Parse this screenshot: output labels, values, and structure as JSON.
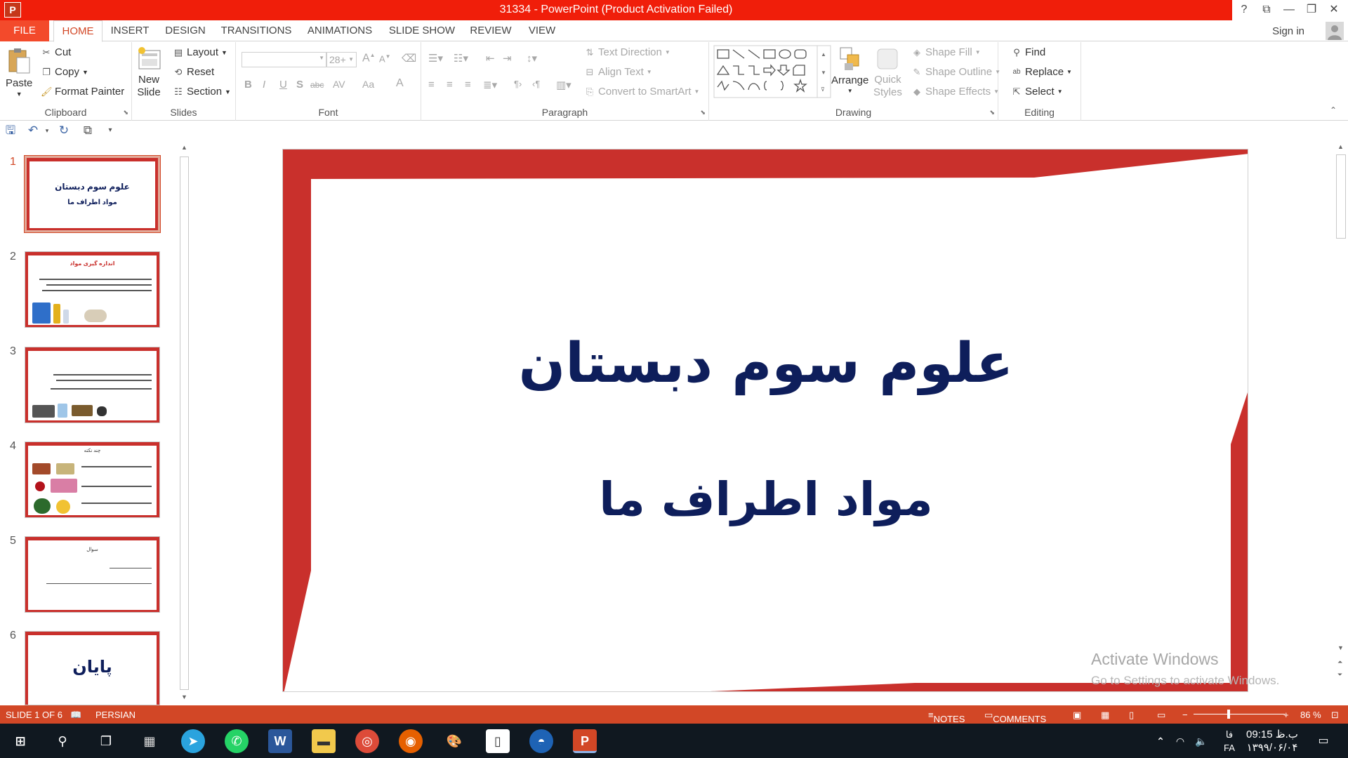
{
  "window": {
    "title": "31334 -  PowerPoint (Product Activation Failed)",
    "app_icon_letter": "P",
    "controls": [
      "?",
      "⧉",
      "—",
      "❐",
      "✕"
    ],
    "title_color": "#f01e0a"
  },
  "tabs": [
    "FILE",
    "HOME",
    "INSERT",
    "DESIGN",
    "TRANSITIONS",
    "ANIMATIONS",
    "SLIDE SHOW",
    "REVIEW",
    "VIEW"
  ],
  "active_tab": "HOME",
  "signin": "Sign in",
  "ribbon": {
    "clipboard": {
      "label": "Clipboard",
      "paste": "Paste",
      "cut": "Cut",
      "copy": "Copy",
      "format_painter": "Format Painter"
    },
    "slides": {
      "label": "Slides",
      "new_slide": "New",
      "new_slide_2": "Slide",
      "layout": "Layout",
      "reset": "Reset",
      "section": "Section"
    },
    "font": {
      "label": "Font",
      "font_name": "",
      "font_size": "28+",
      "bold": "B",
      "italic": "I",
      "underline": "U",
      "shadow": "S",
      "strike": "abc",
      "spacing": "AV",
      "case": "Aa",
      "color": "A"
    },
    "paragraph": {
      "label": "Paragraph",
      "text_direction": "Text Direction",
      "align_text": "Align Text",
      "convert_smartart": "Convert to SmartArt"
    },
    "drawing": {
      "label": "Drawing",
      "arrange": "Arrange",
      "quick_styles": "Quick",
      "quick_styles_2": "Styles",
      "shape_fill": "Shape Fill",
      "shape_outline": "Shape Outline",
      "shape_effects": "Shape Effects"
    },
    "editing": {
      "label": "Editing",
      "find": "Find",
      "replace": "Replace",
      "select": "Select"
    }
  },
  "thumbnails": [
    {
      "num": "1",
      "title": "علوم سوم دبستان",
      "subtitle": "مواد اطراف ما"
    },
    {
      "num": "2",
      "title": "اندازه گیری مواد"
    },
    {
      "num": "3"
    },
    {
      "num": "4",
      "title": "چند نکته"
    },
    {
      "num": "5",
      "title": "سوال"
    },
    {
      "num": "6",
      "title": "پایان"
    }
  ],
  "slide": {
    "title": "علوم سوم دبستان",
    "subtitle": "مواد اطراف ما",
    "frame_color": "#c9302c",
    "text_color": "#0e1e5b"
  },
  "watermark": {
    "line1": "Activate Windows",
    "line2": "Go to Settings to activate Windows."
  },
  "statusbar": {
    "slide_info": "SLIDE 1 OF 6",
    "language": "PERSIAN",
    "notes": "NOTES",
    "comments": "COMMENTS",
    "zoom": "86 %",
    "minus": "−",
    "plus": "+",
    "color": "#d24726"
  },
  "taskbar": {
    "lang": "FA",
    "lang2": "فا",
    "time": "09:15 ب.ظ",
    "date": "۱۳۹۹/۰۶/۰۴"
  }
}
